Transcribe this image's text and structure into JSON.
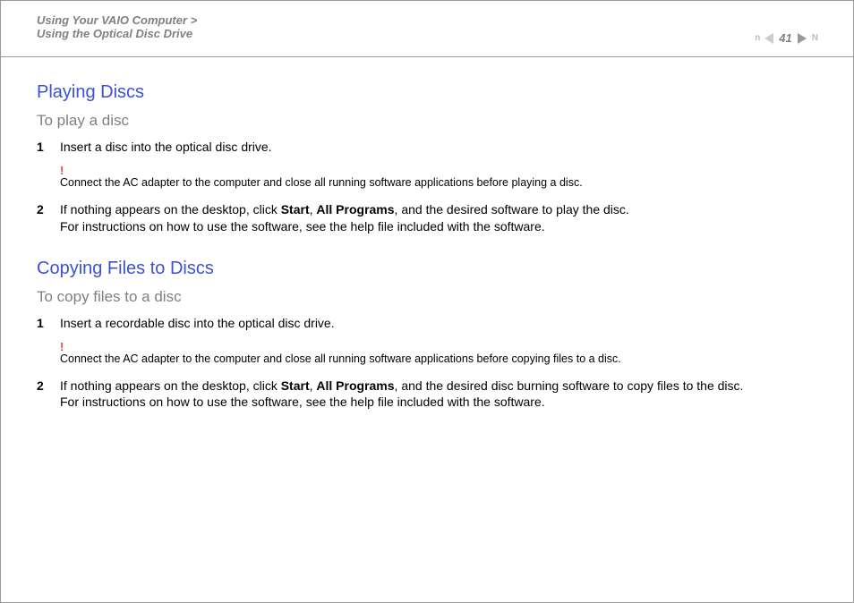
{
  "header": {
    "breadcrumb_line1": "Using Your VAIO Computer >",
    "breadcrumb_line2": "Using the Optical Disc Drive",
    "page_number": "41",
    "prev_label": "n",
    "next_label": "N"
  },
  "section1": {
    "title": "Playing Discs",
    "subtitle": "To play a disc",
    "steps": [
      {
        "num": "1",
        "text": "Insert a disc into the optical disc drive."
      },
      {
        "num": "2",
        "text_a": "If nothing appears on the desktop, click ",
        "bold1": "Start",
        "text_b": ", ",
        "bold2": "All Programs",
        "text_c": ", and the desired software to play the disc.",
        "text_d": "For instructions on how to use the software, see the help file included with the software."
      }
    ],
    "note_bang": "!",
    "note_text": "Connect the AC adapter to the computer and close all running software applications before playing a disc."
  },
  "section2": {
    "title": "Copying Files to Discs",
    "subtitle": "To copy files to a disc",
    "steps": [
      {
        "num": "1",
        "text": "Insert a recordable disc into the optical disc drive."
      },
      {
        "num": "2",
        "text_a": "If nothing appears on the desktop, click ",
        "bold1": "Start",
        "text_b": ", ",
        "bold2": "All Programs",
        "text_c": ", and the desired disc burning software to copy files to the disc.",
        "text_d": "For instructions on how to use the software, see the help file included with the software."
      }
    ],
    "note_bang": "!",
    "note_text": "Connect the AC adapter to the computer and close all running software applications before copying files to a disc."
  }
}
